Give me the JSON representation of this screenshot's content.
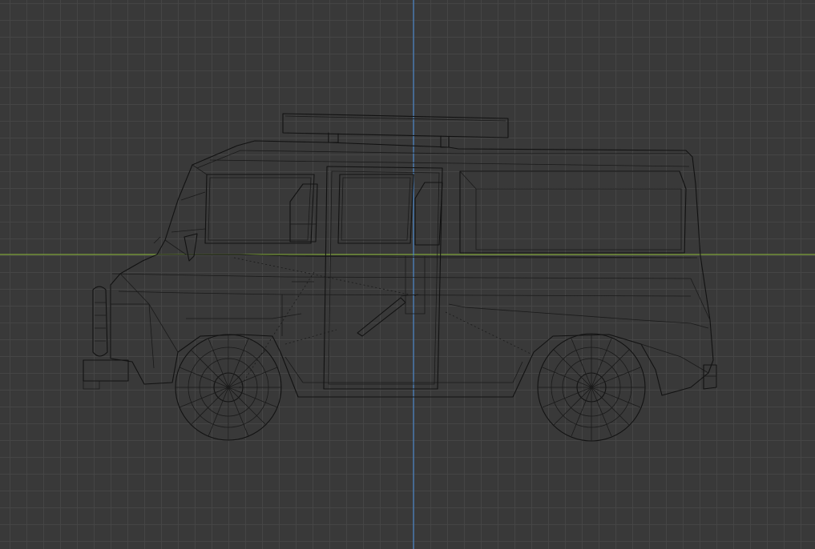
{
  "app": {
    "view": "orthographic-side-wireframe"
  },
  "viewport": {
    "background_color": "#393939",
    "grid_color": "#464646",
    "x_axis_color": "#7ea33a",
    "y_axis_color": "#4a86c8",
    "wire_color": "#121212"
  },
  "model": {
    "object": "van-wireframe",
    "wheels": 2
  }
}
